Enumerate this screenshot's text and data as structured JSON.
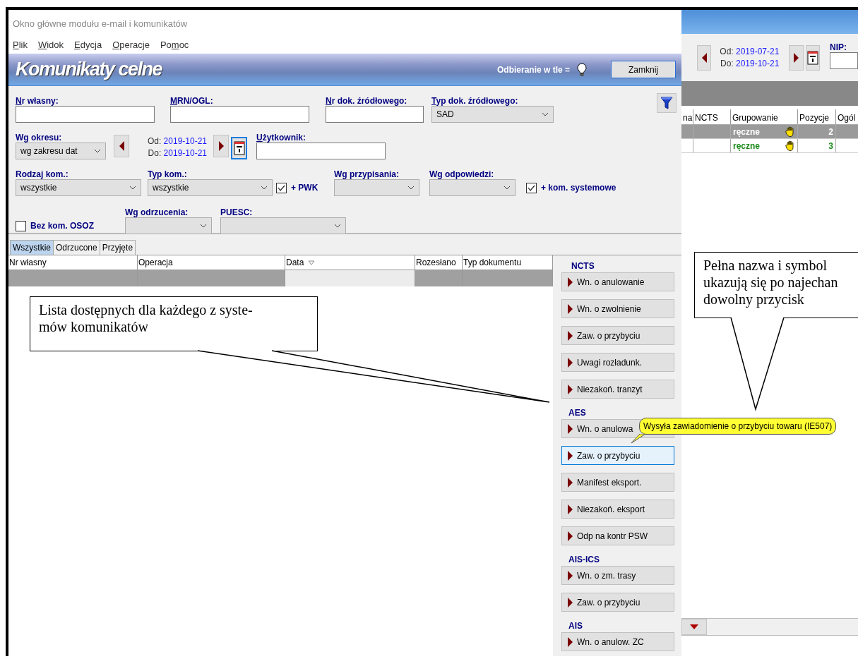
{
  "background_window": {
    "period": {
      "from_label": "Od:",
      "from": "2019-07-21",
      "to_label": "Do:",
      "to": "2019-10-21"
    },
    "nip_label": "NIP:",
    "columns": [
      "na",
      "NCTS",
      "Grupowanie",
      "Pozycje",
      "Ogól"
    ],
    "rows": [
      {
        "selected": true,
        "grouping": "ręczne",
        "positions": "2"
      },
      {
        "selected": false,
        "grouping": "ręczne",
        "positions": "3"
      }
    ]
  },
  "window": {
    "title": "Okno główne modułu e-mail i komunikatów"
  },
  "menu": [
    {
      "label": {
        "key": "P",
        "after": "lik"
      }
    },
    {
      "label": {
        "key": "W",
        "after": "idok"
      }
    },
    {
      "label": {
        "key": "E",
        "after": "dycja"
      }
    },
    {
      "label": {
        "key": "O",
        "after": "peracje"
      }
    },
    {
      "label": {
        "before": "Po",
        "key": "m",
        "after": "oc"
      }
    }
  ],
  "header": {
    "title": "Komunikaty celne",
    "background_label": "Odbieranie w tle =",
    "close_button": "Zamknij"
  },
  "filters": [
    [
      {
        "kind": "text",
        "label": {
          "key": "N",
          "after": "r własny:"
        }
      },
      {
        "kind": "text",
        "label": {
          "key": "M",
          "after": "RN/OGL:"
        }
      },
      {
        "kind": "text",
        "label": {
          "key": "N",
          "after": "r dok. źródłowego:"
        }
      },
      {
        "kind": "select",
        "label": {
          "key": "T",
          "after": "yp dok. źródłowego:"
        },
        "value": "SAD"
      },
      {
        "kind": "filter"
      }
    ],
    [
      {
        "kind": "select",
        "label": "Wg okresu:",
        "value": "wg zakresu dat"
      },
      {
        "kind": "prev"
      },
      {
        "kind": "dates",
        "from_label": "Od:",
        "from": "2019-10-21",
        "to_label": "Do:",
        "to": "2019-10-21"
      },
      {
        "kind": "next"
      },
      {
        "kind": "calendar",
        "focused": true
      },
      {
        "kind": "text",
        "label": {
          "key": "U",
          "after": "żytkownik:"
        }
      }
    ],
    [
      {
        "kind": "select",
        "label": "Rodzaj kom.:",
        "value": "wszystkie"
      },
      {
        "kind": "select",
        "label": "Typ kom.:",
        "value": "wszystkie"
      },
      {
        "kind": "checkbox",
        "label": "+ PWK",
        "checked": true
      },
      {
        "kind": "select",
        "label": "Wg przypisania:"
      },
      {
        "kind": "select",
        "label": "Wg odpowiedzi:"
      },
      {
        "kind": "checkbox",
        "label": "+ kom. systemowe",
        "checked": true
      }
    ],
    [
      {
        "kind": "checkbox",
        "label": "Bez kom. OSOZ",
        "checked": false
      },
      {
        "kind": "select",
        "label": "Wg odrzucenia:"
      },
      {
        "kind": "select",
        "label": "PUESC:"
      }
    ]
  ],
  "tabs": [
    {
      "label": "Wszystkie",
      "selected": true
    },
    {
      "label": "Odrzucone",
      "selected": false
    },
    {
      "label": "Przyjęte",
      "selected": false
    }
  ],
  "grid": {
    "columns": [
      {
        "label": "Nr własny",
        "sorted": false
      },
      {
        "label": "Operacja",
        "sorted": false
      },
      {
        "label": "Data",
        "sorted": true
      },
      {
        "label": "Rozesłano",
        "sorted": false
      },
      {
        "label": "Typ dokumentu",
        "sorted": false
      }
    ],
    "rows": [
      {
        "selected": true
      }
    ]
  },
  "actions": [
    {
      "title": "NCTS",
      "buttons": [
        {
          "label": "Wn. o anulowanie",
          "hovered": false
        },
        {
          "label": "Wn. o zwolnienie",
          "hovered": false
        },
        {
          "label": "Zaw. o przybyciu",
          "hovered": false
        },
        {
          "label": "Uwagi rozładunk.",
          "hovered": false
        },
        {
          "label": "Niezakoń. tranzyt",
          "hovered": false
        }
      ]
    },
    {
      "title": "AES",
      "buttons": [
        {
          "label": "Wn. o anulowa",
          "hovered": false
        },
        {
          "label": "Zaw. o przybyciu",
          "hovered": true
        },
        {
          "label": "Manifest eksport.",
          "hovered": false
        },
        {
          "label": "Niezakoń. eksport",
          "hovered": false
        },
        {
          "label": "Odp na kontr PSW",
          "hovered": false
        }
      ]
    },
    {
      "title": "AIS-ICS",
      "buttons": [
        {
          "label": "Wn. o zm. trasy",
          "hovered": false
        },
        {
          "label": "Zaw. o przybyciu",
          "hovered": false
        }
      ]
    },
    {
      "title": "AIS",
      "buttons": [
        {
          "label": "Wn. o anulow. ZC",
          "hovered": false
        }
      ]
    }
  ],
  "tooltip": "Wysyła zawiadomienie o przybyciu towaru (IE507)",
  "callouts": [
    {
      "lines": [
        "Lista dostępnych dla każdego z syste-",
        "mów komunikatów"
      ]
    },
    {
      "lines": [
        "Pełna nazwa i symbol",
        "ukazują się po najechan",
        "dowolny przycisk"
      ]
    }
  ]
}
